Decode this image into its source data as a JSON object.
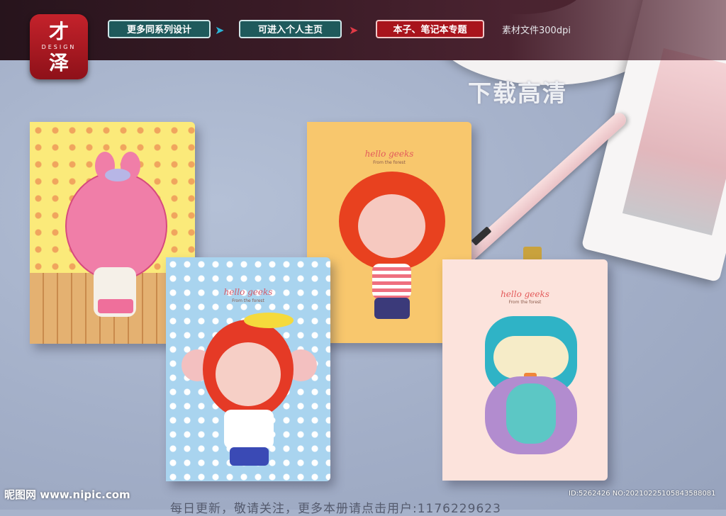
{
  "logo": {
    "top": "才",
    "middle": "DESIGN",
    "bottom": "泽"
  },
  "nav": {
    "btn1": "更多同系列设计",
    "btn2": "可进入个人主页",
    "btn3": "本子、笔记本专题",
    "note": "素材文件300dpi"
  },
  "download": "下载高清",
  "notebooks": {
    "title": "hello geeks",
    "subtitle": "From the forest"
  },
  "footer": {
    "slogan": "每日更新，敬请关注，更多本册请点击用户:1176229623",
    "watermark": "昵图网 www.nipic.com",
    "id": "ID:5262426 NO:20210225105843588081"
  }
}
